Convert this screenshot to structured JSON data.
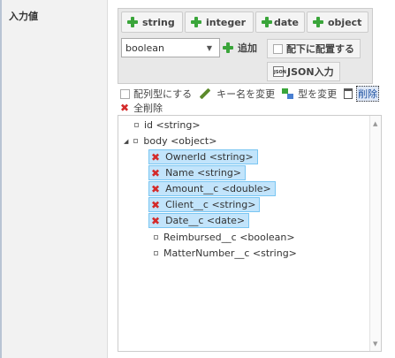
{
  "field_label": "入力値",
  "type_buttons": [
    "string",
    "integer",
    "date",
    "object"
  ],
  "type_select": {
    "value": "boolean"
  },
  "add_label": "追加",
  "place_child_label": "配下に配置する",
  "json_input_label": "JSON入力",
  "json_icon_text": "JSON",
  "toolbar": {
    "array_label": "配列型にする",
    "rename_label": "キー名を変更",
    "change_type_label": "型を変更",
    "delete_label": "削除",
    "delete_all_label": "全削除"
  },
  "tree": {
    "nodes": [
      {
        "label": "id <string>",
        "selected": false
      },
      {
        "label": "body <object>",
        "selected": false
      },
      {
        "label": "OwnerId <string>",
        "selected": true
      },
      {
        "label": "Name <string>",
        "selected": true
      },
      {
        "label": "Amount__c <double>",
        "selected": true
      },
      {
        "label": "Client__c <string>",
        "selected": true
      },
      {
        "label": "Date__c <date>",
        "selected": true
      },
      {
        "label": "Reimbursed__c <boolean>",
        "selected": false
      },
      {
        "label": "MatterNumber__c <string>",
        "selected": false
      }
    ]
  }
}
